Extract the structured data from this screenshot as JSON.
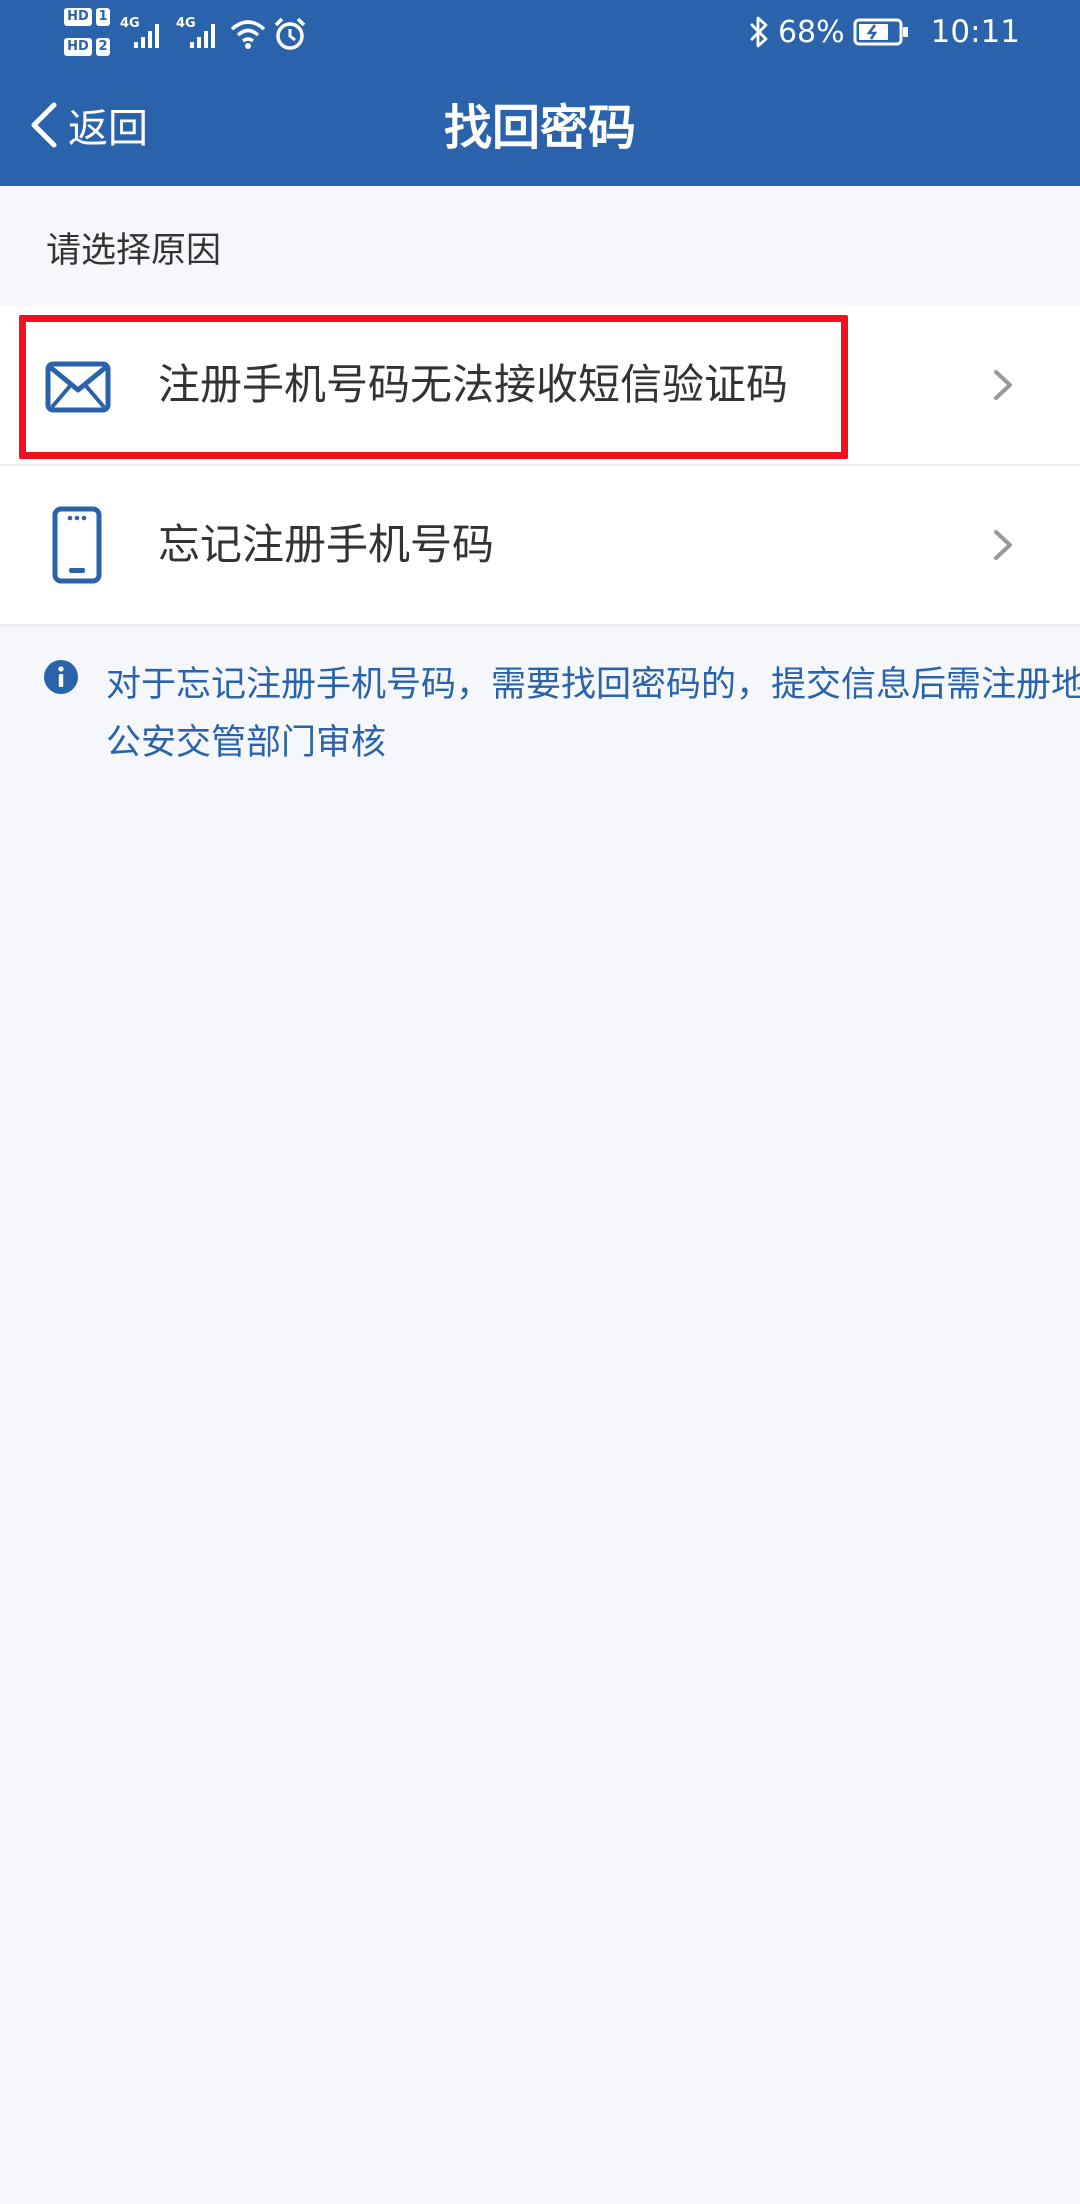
{
  "status_bar": {
    "sim1_badge": "HD",
    "sim1_num": "1",
    "sim2_badge": "HD",
    "sim2_num": "2",
    "network1": "4G",
    "network2": "4G",
    "icons": [
      "signal-icon",
      "signal-icon",
      "wifi-icon",
      "alarm-icon",
      "bluetooth-icon",
      "battery-icon"
    ],
    "battery_percent": "68%",
    "time": "10:11"
  },
  "nav": {
    "back_label": "返回",
    "title": "找回密码"
  },
  "section_label": "请选择原因",
  "options": [
    {
      "label": "注册手机号码无法接收短信验证码",
      "icon": "envelope-icon",
      "highlighted": true
    },
    {
      "label": "忘记注册手机号码",
      "icon": "phone-icon",
      "highlighted": false
    }
  ],
  "notice": {
    "icon": "info-icon",
    "text": "对于忘记注册手机号码，需要找回密码的，提交信息后需注册地公安交管部门审核"
  },
  "colors": {
    "header": "#2a63ab",
    "accent": "#2a63ab",
    "highlight": "#f0101e",
    "background": "#f5f7fa"
  }
}
